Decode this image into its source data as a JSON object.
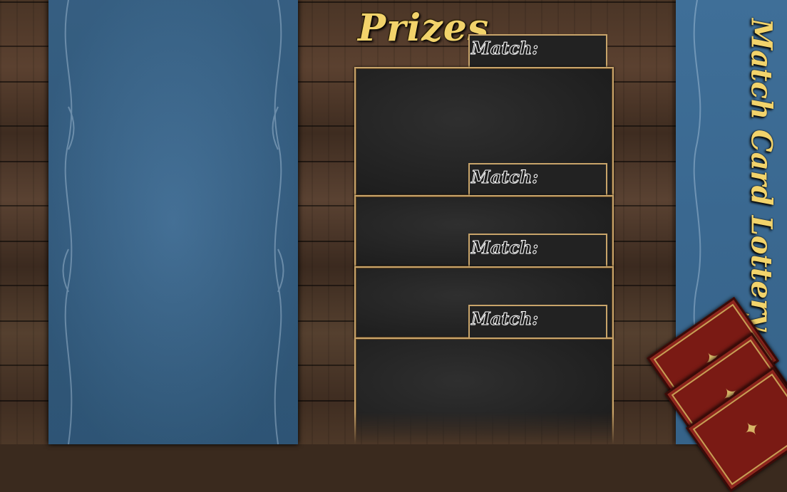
{
  "header": {
    "title": "Prizes"
  },
  "side_title": "Match Card Lottery",
  "prize_slots": [
    {
      "match_label": "Match:"
    },
    {
      "match_label": "Match:"
    },
    {
      "match_label": "Match:"
    },
    {
      "match_label": "Match:"
    }
  ],
  "card_stack": {
    "icon": "card-back-icon",
    "count": 3
  },
  "colors": {
    "gold": "#f2d36b",
    "panel_blue": "#3a6890",
    "slot_border": "#c8a46a",
    "card_red": "#7a1a14"
  }
}
